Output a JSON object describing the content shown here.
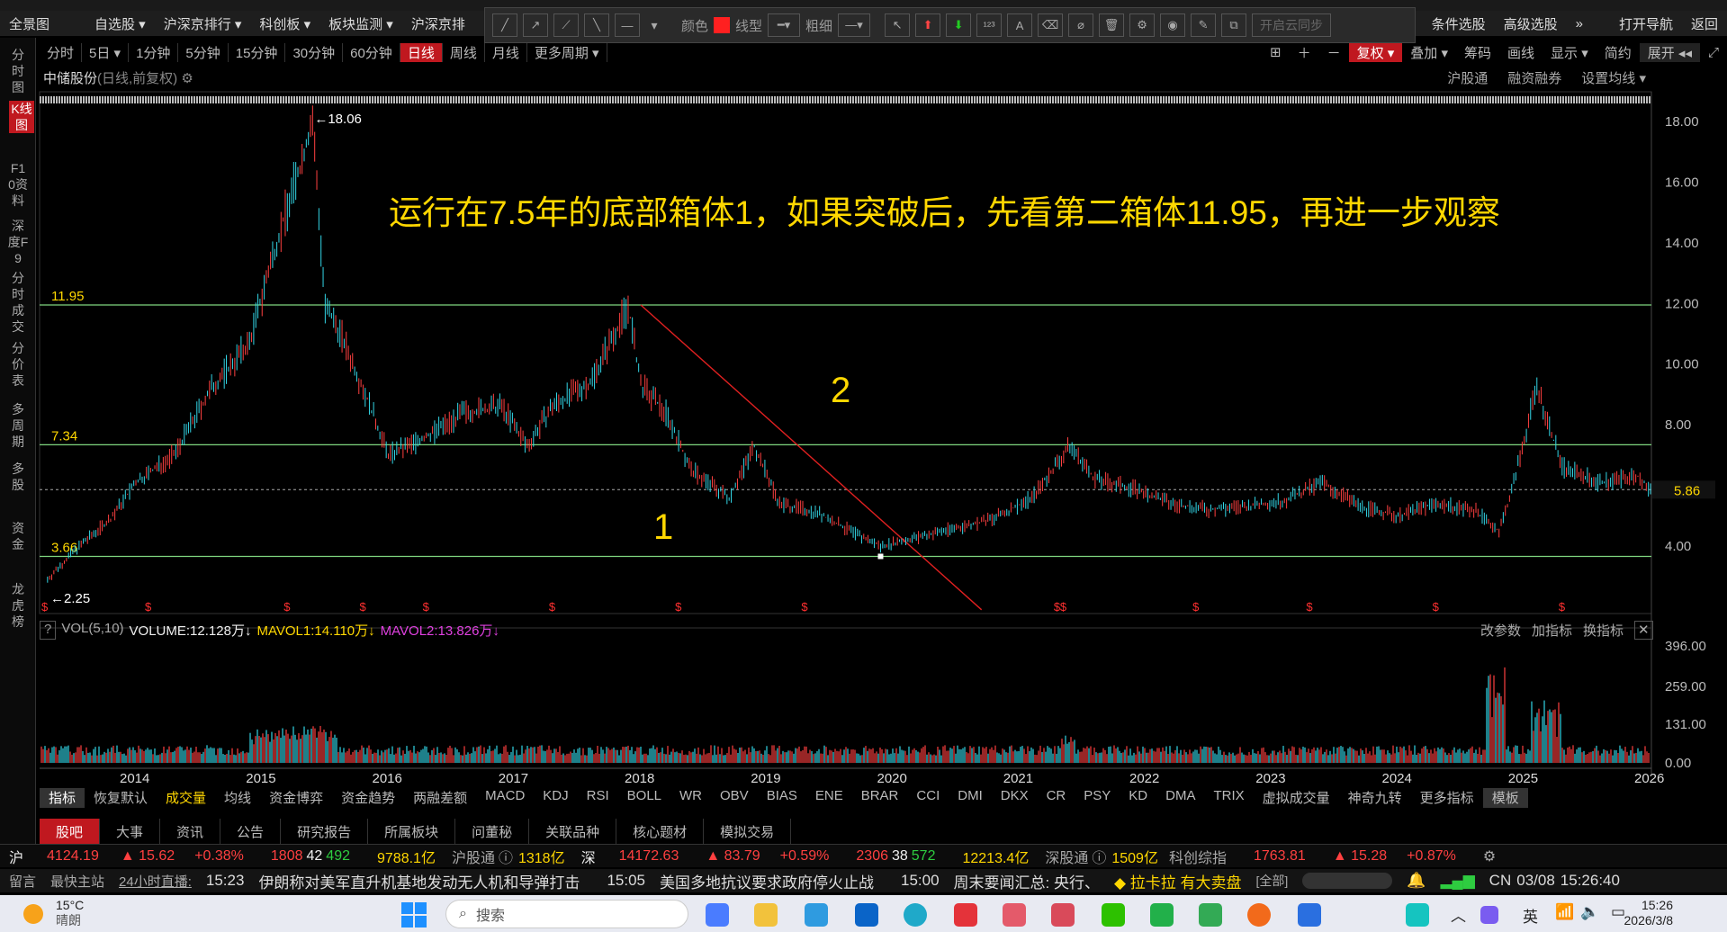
{
  "app": {
    "menu": [
      "全景图",
      "自选股 ▾",
      "沪深京排行 ▾",
      "科创板 ▾",
      "板块监测 ▾",
      "沪深京排"
    ],
    "menu_right": [
      "条件选股",
      "高级选股",
      "»",
      "打开导航",
      "返回"
    ]
  },
  "drawbar": {
    "color_label": "颜色",
    "line_label": "线型",
    "width_label": "粗细",
    "sync_label": "开启云同步",
    "line_color": "#ff2020"
  },
  "periods": [
    "分时",
    "5日 ▾",
    "1分钟",
    "5分钟",
    "15分钟",
    "30分钟",
    "60分钟",
    "日线",
    "周线",
    "月线",
    "更多周期 ▾"
  ],
  "active_period": "日线",
  "rightbar": [
    "复权 ▾",
    "叠加 ▾",
    "筹码",
    "画线",
    "显示 ▾",
    "简约",
    "展开 ◂◂"
  ],
  "sidebar": [
    "分时图",
    "K线图",
    "F10资料",
    "深度F9",
    "分时成交",
    "分价表",
    "多周期",
    "多股",
    "资金",
    "龙虎榜"
  ],
  "stock": {
    "name": "中储股份",
    "subtitle": "(日线,前复权)"
  },
  "stock_right": [
    "沪股通",
    "融资融券",
    "设置均线 ▾"
  ],
  "annotations": {
    "headline": "运行在7.5年的底部箱体1，如果突破后，先看第二箱体11.95，再进一步观察",
    "box1": "1",
    "box2": "2",
    "high_label": "←18.06",
    "low_label": "←2.25",
    "line_1195": "11.95",
    "line_734": "7.34",
    "line_366": "3.66",
    "current_price": "5.86"
  },
  "chart_data": {
    "type": "line",
    "title": "中储股份",
    "x_ticks": [
      "2014",
      "2015",
      "2016",
      "2017",
      "2018",
      "2019",
      "2020",
      "2021",
      "2022",
      "2023",
      "2024",
      "2025",
      "2026"
    ],
    "y_ticks": [
      "18.00",
      "16.00",
      "14.00",
      "12.00",
      "10.00",
      "8.00",
      "4.00"
    ],
    "ylim": [
      2.0,
      19.0
    ],
    "series": [
      {
        "x": [
          2013.3,
          2013.5,
          2013.8,
          2014.0,
          2014.3,
          2014.6,
          2014.9,
          2015.1,
          2015.3,
          2015.4,
          2015.5,
          2015.6,
          2015.8,
          2016.0,
          2016.3,
          2016.6,
          2016.9,
          2017.1,
          2017.3,
          2017.6,
          2017.9,
          2018.0,
          2018.2,
          2018.4,
          2018.7,
          2018.9,
          2019.1,
          2019.4,
          2019.7,
          2019.9,
          2020.2,
          2020.5,
          2020.8,
          2021.1,
          2021.4,
          2021.6,
          2021.9,
          2022.2,
          2022.5,
          2022.8,
          2023.1,
          2023.4,
          2023.7,
          2024.0,
          2024.3,
          2024.6,
          2024.8,
          2024.9,
          2025.1,
          2025.3,
          2025.6,
          2025.9,
          2026.0
        ],
        "y": [
          2.9,
          3.8,
          4.9,
          6.1,
          7.0,
          9.2,
          10.7,
          13.8,
          16.5,
          18.06,
          11.8,
          11.2,
          9.2,
          7.0,
          7.6,
          8.4,
          8.6,
          7.3,
          8.6,
          9.4,
          11.95,
          9.3,
          8.4,
          6.5,
          5.6,
          7.3,
          5.4,
          5.1,
          4.4,
          4.0,
          4.3,
          4.6,
          4.9,
          5.6,
          7.3,
          6.2,
          5.9,
          5.4,
          5.2,
          5.3,
          5.5,
          6.1,
          5.3,
          5.0,
          5.4,
          5.2,
          4.5,
          5.8,
          9.3,
          6.6,
          6.1,
          6.3,
          5.86
        ]
      }
    ],
    "hlines": [
      11.95,
      7.34,
      3.66,
      5.86
    ],
    "trendline": [
      [
        2018.0,
        11.95
      ],
      [
        2020.7,
        1.9
      ]
    ]
  },
  "volume_panel": {
    "label_vol": "VOL(5,10)",
    "label_volume": "VOLUME:12.128万↓",
    "label_mavol1": "MAVOL1:14.110万↓",
    "label_mavol2": "MAVOL2:13.826万↓",
    "buttons": [
      "改参数",
      "加指标",
      "换指标"
    ],
    "y_ticks": [
      "396.00",
      "259.00",
      "131.00",
      "0.00"
    ]
  },
  "indicator_tabs": [
    "指标",
    "恢复默认",
    "成交量",
    "均线",
    "资金博弈",
    "资金趋势",
    "两融差额",
    "MACD",
    "KDJ",
    "RSI",
    "BOLL",
    "WR",
    "OBV",
    "BIAS",
    "ENE",
    "BRAR",
    "CCI",
    "DMI",
    "DKX",
    "CR",
    "PSY",
    "KD",
    "DMA",
    "TRIX",
    "虚拟成交量",
    "神奇九转",
    "更多指标",
    "模板"
  ],
  "info_tabs": [
    "股吧",
    "大事",
    "资讯",
    "公告",
    "研究报告",
    "所属板块",
    "问董秘",
    "关联品种",
    "核心题材",
    "模拟交易"
  ],
  "status": {
    "sh_label": "沪",
    "sh_index": "4124.19",
    "sh_change": "▲ 15.62",
    "sh_pct": "+0.38%",
    "sh_up": "1808",
    "sh_flat": "42",
    "sh_down": "492",
    "sh_amount": "9788.1亿",
    "hgt_label": "沪股通",
    "hgt_value": "1318亿",
    "sz_label": "深",
    "sz_index": "14172.63",
    "sz_change": "▲ 83.79",
    "sz_pct": "+0.59%",
    "sz_up": "2306",
    "sz_flat": "38",
    "sz_down": "572",
    "sz_amount": "12213.4亿",
    "sgt_label": "深股通",
    "sgt_value": "1509亿",
    "kc_label": "科创综指",
    "kc_index": "1763.81",
    "kc_change": "▲ 15.28",
    "kc_pct": "+0.87%"
  },
  "news": {
    "leave_msg": "留言",
    "quick": "最快主站",
    "live": "24小时直播:",
    "items": [
      {
        "time": "15:23",
        "text": "伊朗称对美军直升机基地发动无人机和导弹打击"
      },
      {
        "time": "15:05",
        "text": "美国多地抗议要求政府停火止战"
      },
      {
        "time": "15:00",
        "text": "周末要闻汇总: 央行、"
      }
    ],
    "ad": "拉卡拉 有大卖盘",
    "all": "[全部]",
    "cn": "CN",
    "date": "03/08",
    "time": "15:26:40"
  },
  "taskbar": {
    "weather_temp": "15°C",
    "weather_desc": "晴朗",
    "search_placeholder": "搜索",
    "ime": "英",
    "clock_time": "15:26",
    "clock_date": "2026/3/8"
  }
}
